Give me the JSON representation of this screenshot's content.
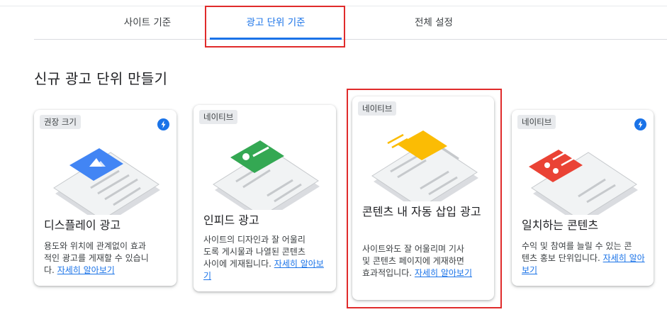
{
  "tabs": [
    {
      "label": "사이트 기준",
      "active": false
    },
    {
      "label": "광고 단위 기준",
      "active": true
    },
    {
      "label": "전체 설정",
      "active": false
    }
  ],
  "section_title": "신규 광고 단위 만들기",
  "accent_color": "#1a73e8",
  "highlight_color": "#e02b2b",
  "cards": [
    {
      "badge": "권장 크기",
      "has_bolt_icon": true,
      "illustration": "display-ad-illustration",
      "illustration_color": "#4285f4",
      "title": "디스플레이 광고",
      "desc_lines": [
        "용도와 위치에 관계없이 효과",
        "적인 광고를 게재할 수 있습니",
        "다."
      ],
      "learn_more": "자세히 알아보기"
    },
    {
      "badge": "네이티브",
      "has_bolt_icon": false,
      "illustration": "infeed-ad-illustration",
      "illustration_color": "#34a853",
      "title": "인피드 광고",
      "desc_lines": [
        "사이트의 디자인과 잘 어울리",
        "도록 게시물과 나열된 콘텐츠",
        "사이에 게재됩니다."
      ],
      "learn_more": "자세히 알아보기"
    },
    {
      "badge": "네이티브",
      "has_bolt_icon": false,
      "illustration": "in-article-ad-illustration",
      "illustration_color": "#fbbc04",
      "title": "콘텐츠 내 자동 삽입 광고",
      "desc_lines": [
        "사이트와도 잘 어울리며 기사",
        "및 콘텐츠 페이지에 게재하면",
        "효과적입니다."
      ],
      "learn_more": "자세히 알아보기"
    },
    {
      "badge": "네이티브",
      "has_bolt_icon": true,
      "illustration": "matched-content-illustration",
      "illustration_color": "#ea4335",
      "title": "일치하는 콘텐츠",
      "desc_lines": [
        "수익 및 참여를 늘릴 수 있는 콘",
        "텐츠 홍보 단위입니다."
      ],
      "learn_more": "자세히 알아보기"
    }
  ]
}
